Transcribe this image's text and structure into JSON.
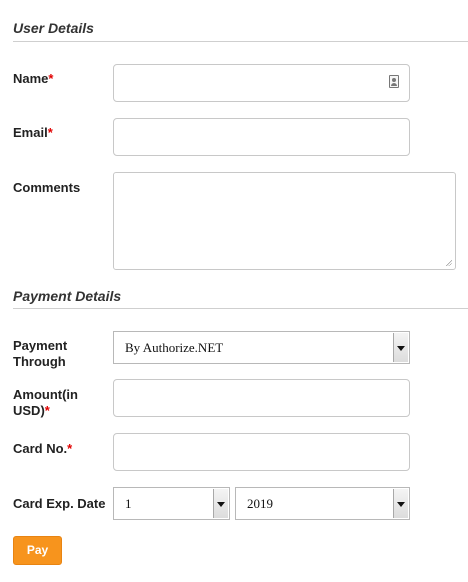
{
  "user_details": {
    "title": "User Details",
    "name_label": "Name",
    "email_label": "Email",
    "comments_label": "Comments",
    "required_mark": "*",
    "name_icon": "contact-card-icon"
  },
  "payment_details": {
    "title": "Payment Details",
    "payment_through_label_1": "Payment",
    "payment_through_label_2": "Through",
    "payment_through_value": "By Authorize.NET",
    "amount_label_1": "Amount(in",
    "amount_label_2": "USD)",
    "card_no_label": "Card No.",
    "card_exp_label": "Card Exp. Date",
    "exp_month_value": "1",
    "exp_year_value": "2019",
    "required_mark": "*"
  },
  "actions": {
    "pay_label": "Pay"
  },
  "colors": {
    "accent": "#f7941d",
    "required": "#e10000"
  }
}
